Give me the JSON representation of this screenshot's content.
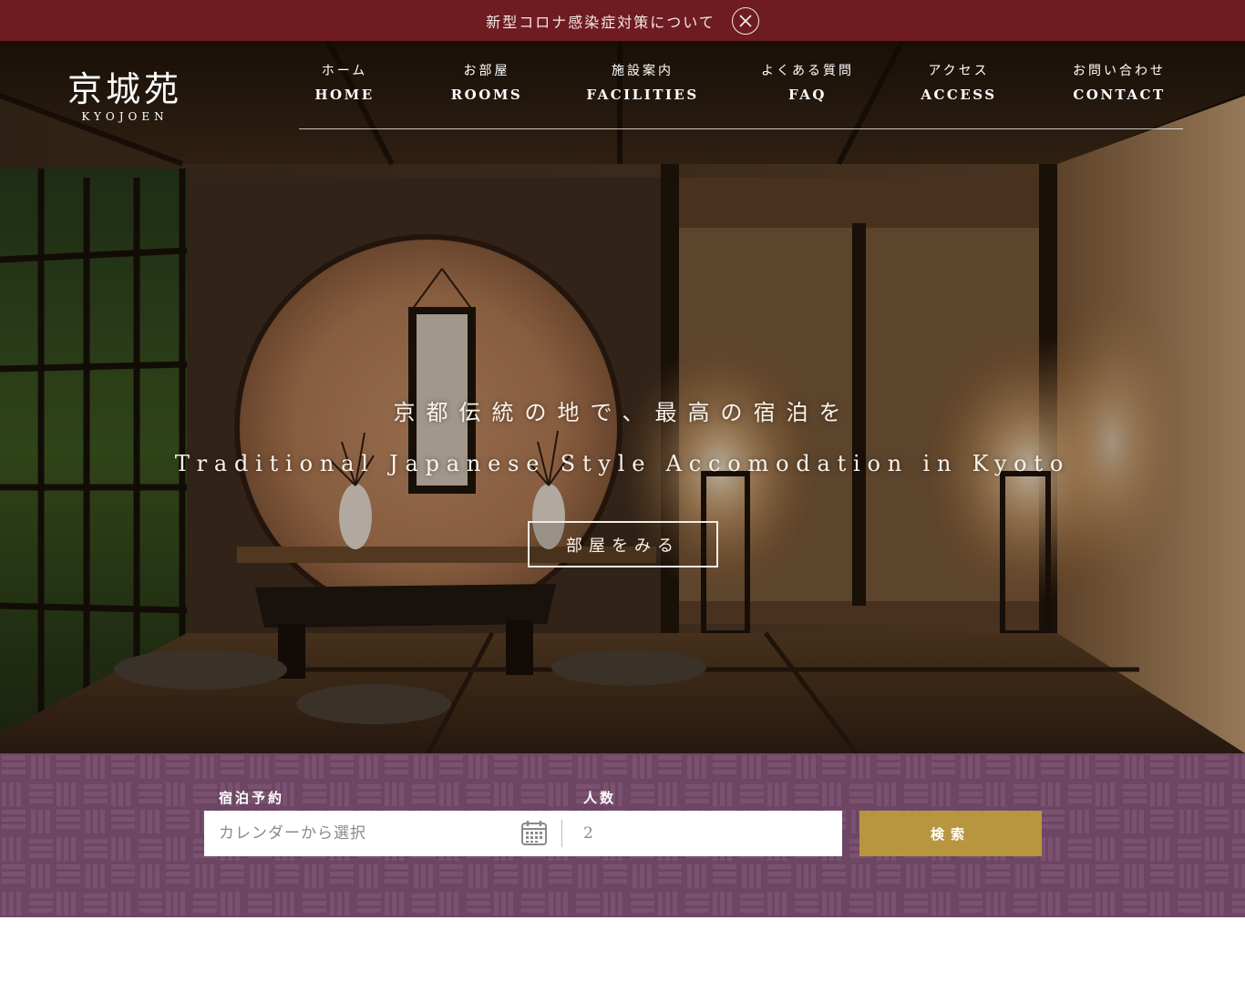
{
  "notice": {
    "text": "新型コロナ感染症対策について"
  },
  "logo": {
    "kanji": "京城苑",
    "roman": "KYOJOEN"
  },
  "nav": [
    {
      "jp": "ホーム",
      "en": "HOME"
    },
    {
      "jp": "お部屋",
      "en": "ROOMS"
    },
    {
      "jp": "施設案内",
      "en": "FACILITIES"
    },
    {
      "jp": "よくある質問",
      "en": "FAQ"
    },
    {
      "jp": "アクセス",
      "en": "ACCESS"
    },
    {
      "jp": "お問い合わせ",
      "en": "CONTACT"
    }
  ],
  "hero": {
    "tagline_jp": "京都伝統の地で、最高の宿泊を",
    "tagline_en": "Traditional Japanese Style Accomodation in Kyoto",
    "cta": "部屋をみる"
  },
  "booking": {
    "stay_label": "宿泊予約",
    "guests_label": "人数",
    "date_placeholder": "カレンダーから選択",
    "guests_value": "2",
    "search_label": "検索"
  },
  "colors": {
    "notice_bg": "#6e1c21",
    "booking_bg": "#6d4663",
    "search_button": "#b8953f"
  },
  "icons": {
    "close": "close-icon",
    "calendar": "calendar-icon"
  }
}
